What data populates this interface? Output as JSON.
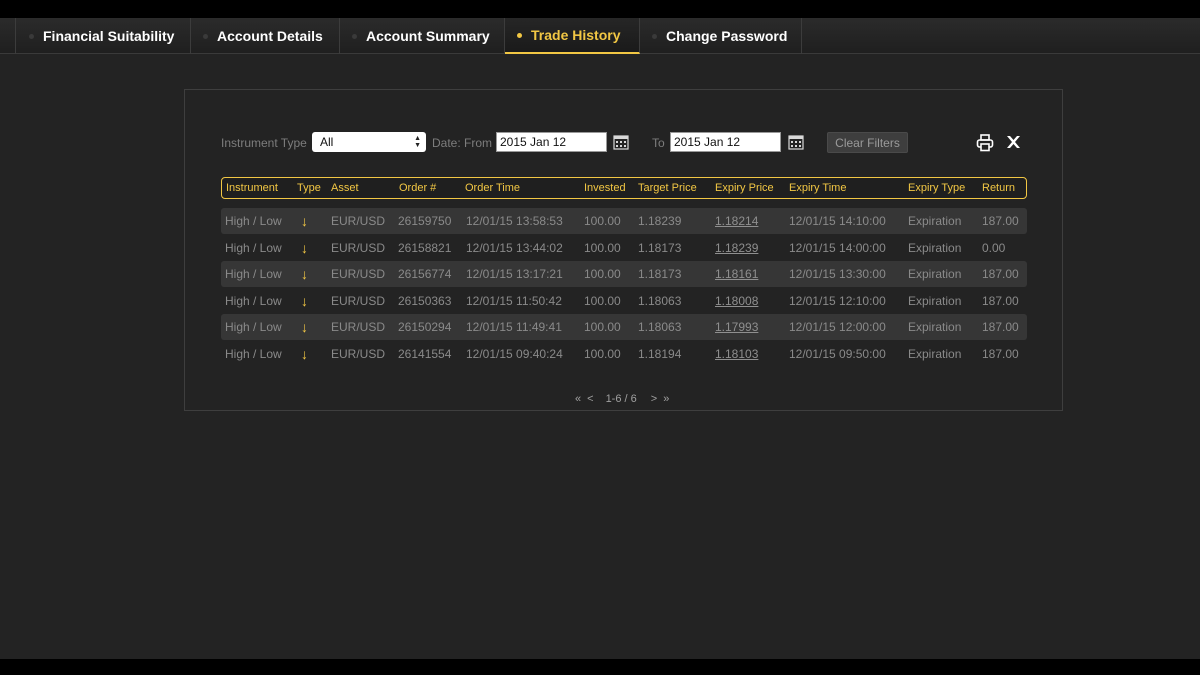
{
  "tabs": [
    {
      "label": "Financial Suitability",
      "active": false
    },
    {
      "label": "Account Details",
      "active": false
    },
    {
      "label": "Account Summary",
      "active": false
    },
    {
      "label": "Trade History",
      "active": true
    },
    {
      "label": "Change Password",
      "active": false
    }
  ],
  "filters": {
    "instrument_label": "Instrument Type",
    "instrument_value": "All",
    "date_label": "Date:",
    "from_label": "From",
    "from_value": "2015 Jan 12",
    "to_label": "To",
    "to_value": "2015 Jan 12",
    "clear_label": "Clear Filters"
  },
  "icons": {
    "calendar": "calendar-icon",
    "print": "printer-icon",
    "excel": "excel-export-icon",
    "type_down": "arrow-down-icon"
  },
  "colors": {
    "accent": "#f2c744",
    "background": "#232323",
    "row_alt": "#363636"
  },
  "table": {
    "columns": [
      "Instrument",
      "Type",
      "Asset",
      "Order #",
      "Order Time",
      "Invested",
      "Target Price",
      "Expiry Price",
      "Expiry Time",
      "Expiry Type",
      "Return"
    ],
    "rows": [
      {
        "instrument": "High / Low",
        "type": "↓",
        "asset": "EUR/USD",
        "order": "26159750",
        "order_time": "12/01/15 13:58:53",
        "invested": "100.00",
        "target": "1.18239",
        "expiry_price": "1.18214",
        "expiry_time": "12/01/15 14:10:00",
        "expiry_type": "Expiration",
        "return": "187.00"
      },
      {
        "instrument": "High / Low",
        "type": "↓",
        "asset": "EUR/USD",
        "order": "26158821",
        "order_time": "12/01/15 13:44:02",
        "invested": "100.00",
        "target": "1.18173",
        "expiry_price": "1.18239",
        "expiry_time": "12/01/15 14:00:00",
        "expiry_type": "Expiration",
        "return": "0.00"
      },
      {
        "instrument": "High / Low",
        "type": "↓",
        "asset": "EUR/USD",
        "order": "26156774",
        "order_time": "12/01/15 13:17:21",
        "invested": "100.00",
        "target": "1.18173",
        "expiry_price": "1.18161",
        "expiry_time": "12/01/15 13:30:00",
        "expiry_type": "Expiration",
        "return": "187.00"
      },
      {
        "instrument": "High / Low",
        "type": "↓",
        "asset": "EUR/USD",
        "order": "26150363",
        "order_time": "12/01/15 11:50:42",
        "invested": "100.00",
        "target": "1.18063",
        "expiry_price": "1.18008",
        "expiry_time": "12/01/15 12:10:00",
        "expiry_type": "Expiration",
        "return": "187.00"
      },
      {
        "instrument": "High / Low",
        "type": "↓",
        "asset": "EUR/USD",
        "order": "26150294",
        "order_time": "12/01/15 11:49:41",
        "invested": "100.00",
        "target": "1.18063",
        "expiry_price": "1.17993",
        "expiry_time": "12/01/15 12:00:00",
        "expiry_type": "Expiration",
        "return": "187.00"
      },
      {
        "instrument": "High / Low",
        "type": "↓",
        "asset": "EUR/USD",
        "order": "26141554",
        "order_time": "12/01/15 09:40:24",
        "invested": "100.00",
        "target": "1.18194",
        "expiry_price": "1.18103",
        "expiry_time": "12/01/15 09:50:00",
        "expiry_type": "Expiration",
        "return": "187.00"
      }
    ]
  },
  "pager": {
    "first": "«",
    "prev": "<",
    "range": "1-6 / 6",
    "next": ">",
    "last": "»"
  }
}
